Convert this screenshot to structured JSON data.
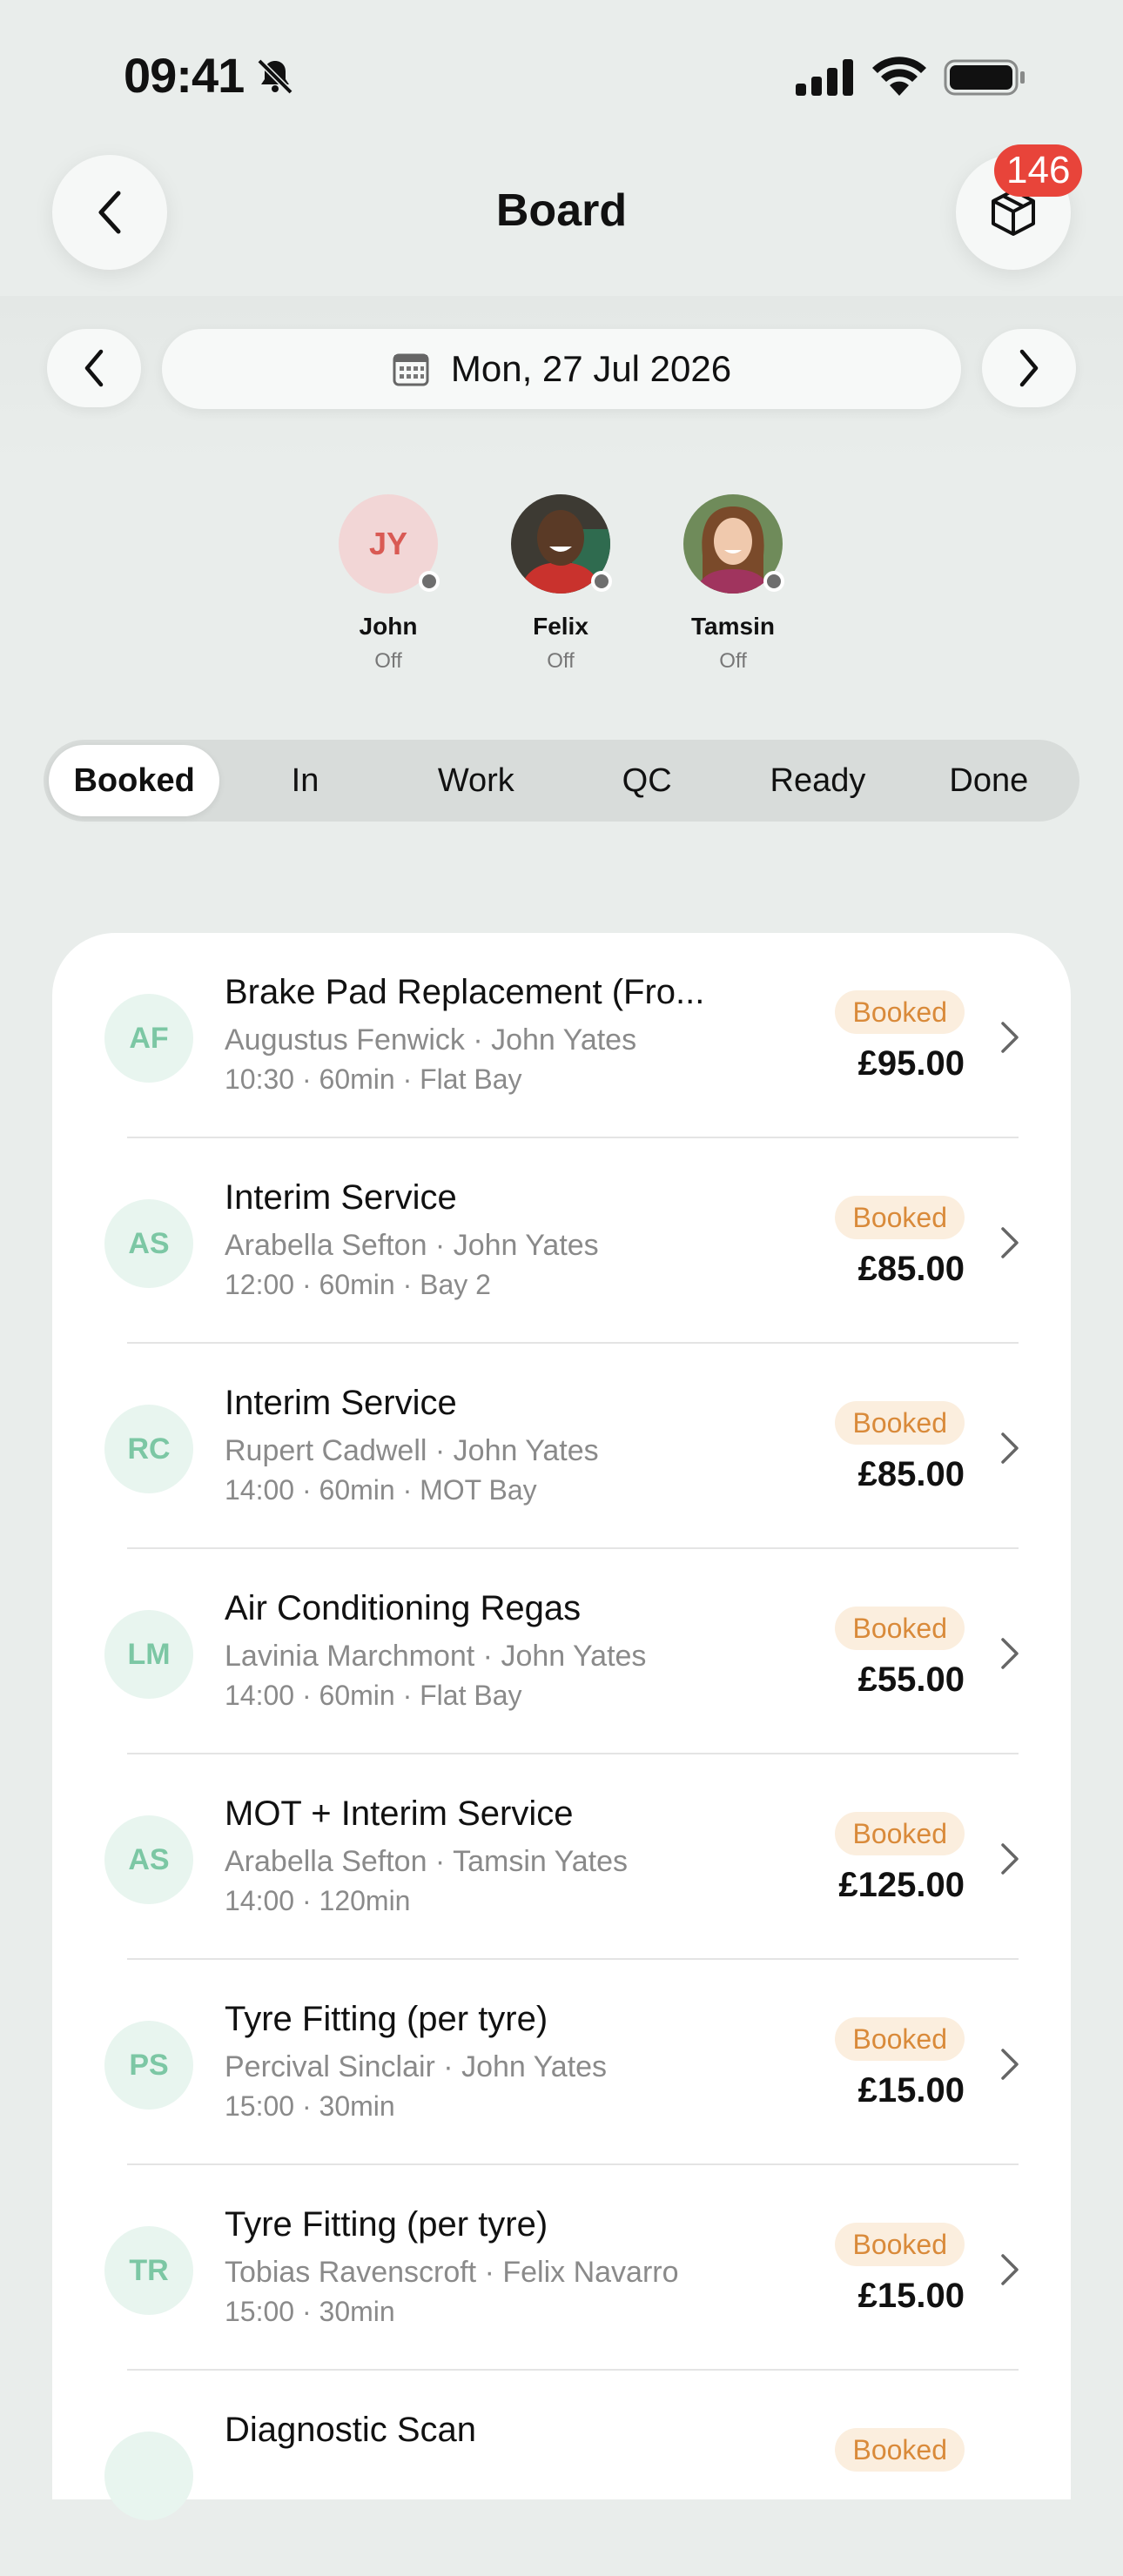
{
  "status_bar": {
    "time": "09:41"
  },
  "header": {
    "title": "Board",
    "badge_count": "146"
  },
  "date_nav": {
    "date": "Mon, 27 Jul 2026"
  },
  "staff": [
    {
      "initials": "JY",
      "name": "John",
      "status": "Off"
    },
    {
      "name": "Felix",
      "status": "Off"
    },
    {
      "name": "Tamsin",
      "status": "Off"
    }
  ],
  "tabs": [
    "Booked",
    "In",
    "Work",
    "QC",
    "Ready",
    "Done"
  ],
  "active_tab": "Booked",
  "colors": {
    "background": "#e9edeb",
    "badge": "#e8443a",
    "status_pill_text": "#d98a3a",
    "avatar_text": "#7cc7a4"
  },
  "jobs": [
    {
      "initials": "AF",
      "title": "Brake Pad Replacement (Fro...",
      "customer": "Augustus Fenwick · John Yates",
      "meta": "10:30  ·  60min  ·  Flat Bay",
      "status": "Booked",
      "price": "£95.00"
    },
    {
      "initials": "AS",
      "title": "Interim Service",
      "customer": "Arabella Sefton · John Yates",
      "meta": "12:00  ·  60min  ·  Bay 2",
      "status": "Booked",
      "price": "£85.00"
    },
    {
      "initials": "RC",
      "title": "Interim Service",
      "customer": "Rupert Cadwell · John Yates",
      "meta": "14:00  ·  60min  ·  MOT Bay",
      "status": "Booked",
      "price": "£85.00"
    },
    {
      "initials": "LM",
      "title": "Air Conditioning Regas",
      "customer": "Lavinia Marchmont · John Yates",
      "meta": "14:00  ·  60min  ·  Flat Bay",
      "status": "Booked",
      "price": "£55.00"
    },
    {
      "initials": "AS",
      "title": "MOT + Interim Service",
      "customer": "Arabella Sefton · Tamsin Yates",
      "meta": "14:00  ·  120min",
      "status": "Booked",
      "price": "£125.00"
    },
    {
      "initials": "PS",
      "title": "Tyre Fitting (per tyre)",
      "customer": "Percival Sinclair · John Yates",
      "meta": "15:00  ·  30min",
      "status": "Booked",
      "price": "£15.00"
    },
    {
      "initials": "TR",
      "title": "Tyre Fitting (per tyre)",
      "customer": "Tobias Ravenscroft · Felix Navarro",
      "meta": "15:00  ·  30min",
      "status": "Booked",
      "price": "£15.00"
    },
    {
      "initials": "",
      "title": "Diagnostic Scan",
      "customer": "",
      "meta": "",
      "status": "Booked",
      "price": ""
    }
  ]
}
